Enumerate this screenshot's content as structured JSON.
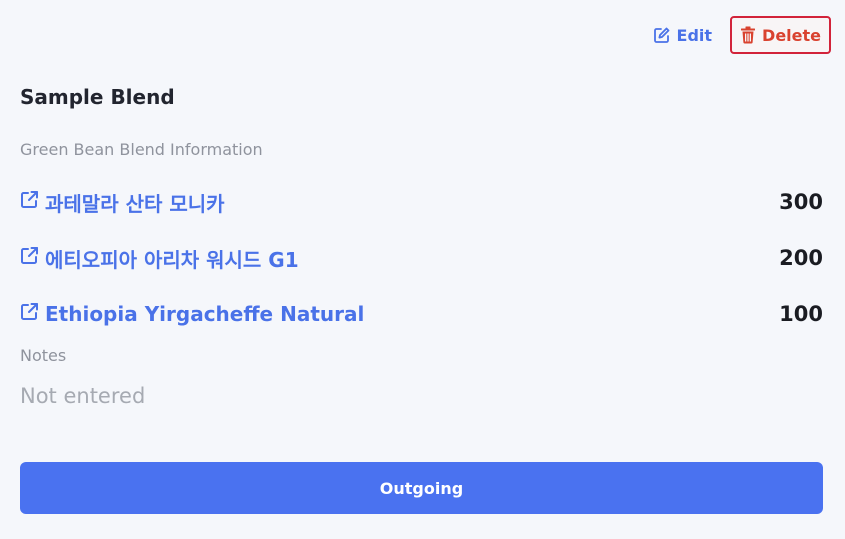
{
  "header": {
    "edit_label": "Edit",
    "delete_label": "Delete"
  },
  "blend": {
    "title": "Sample Blend",
    "section_label": "Green Bean Blend Information",
    "beans": [
      {
        "name": "과테말라 산타 모니카",
        "quantity": "300",
        "icon": "external-link-icon"
      },
      {
        "name": "에티오피아 아리차 워시드 G1",
        "quantity": "200",
        "icon": "external-link-icon"
      },
      {
        "name": "Ethiopia Yirgacheffe Natural",
        "quantity": "100",
        "icon": "external-link-icon"
      }
    ]
  },
  "notes": {
    "label": "Notes",
    "value": "Not entered"
  },
  "footer": {
    "outgoing_label": "Outgoing"
  },
  "colors": {
    "accent": "#4a72f0",
    "link": "#4a72e8",
    "danger": "#d9422f",
    "background": "#f5f7fb"
  }
}
